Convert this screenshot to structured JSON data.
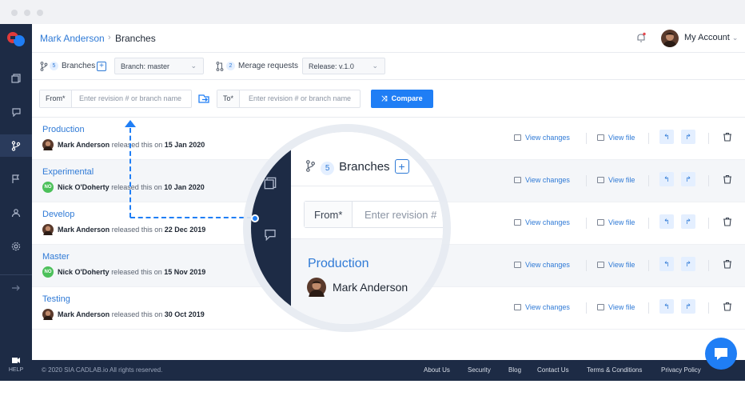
{
  "header": {
    "user": "Mark Anderson",
    "page": "Branches",
    "account_label": "My Account"
  },
  "toolbar": {
    "branches_count": "5",
    "branches_label": "Branches",
    "branch_select": "Branch: master",
    "merge_count": "2",
    "merge_label": "Merage requests",
    "release_select": "Release: v.1.0"
  },
  "compare": {
    "from_label": "From*",
    "from_placeholder": "Enter revision # or branch name",
    "to_label": "To*",
    "to_placeholder": "Enter revision # or branch name",
    "button": "Compare"
  },
  "branches": [
    {
      "name": "Production",
      "author": "Mark Anderson",
      "verb": "released this on",
      "date": "15 Jan 2020"
    },
    {
      "name": "Experimental",
      "author": "Nick O'Doherty",
      "verb": "released this on",
      "date": "10 Jan 2020",
      "initials": "NO"
    },
    {
      "name": "Develop",
      "author": "Mark Anderson",
      "verb": "released this on",
      "date": "22 Dec 2019"
    },
    {
      "name": "Master",
      "author": "Nick O'Doherty",
      "verb": "released this on",
      "date": "15 Nov 2019",
      "initials": "NO"
    },
    {
      "name": "Testing",
      "author": "Mark Anderson",
      "verb": "released this on",
      "date": "30 Oct 2019"
    }
  ],
  "actions": {
    "view_changes": "View changes",
    "view_file": "View file"
  },
  "sidebar": {
    "help_label": "HELP"
  },
  "footer": {
    "copyright": "© 2020 SIA CADLAB.io All rights reserved.",
    "links": [
      "About Us",
      "Security",
      "Blog",
      "Contact Us",
      "Terms & Conditions",
      "Privacy Policy"
    ]
  },
  "magnifier": {
    "branches_count": "5",
    "branches_label": "Branches",
    "from_label": "From*",
    "from_placeholder": "Enter revision #",
    "branch_name": "Production",
    "author": "Mark Anderson"
  },
  "colors": {
    "accent": "#1f7ef5",
    "sidebar": "#1d2b45",
    "link": "#2f7ad6"
  }
}
